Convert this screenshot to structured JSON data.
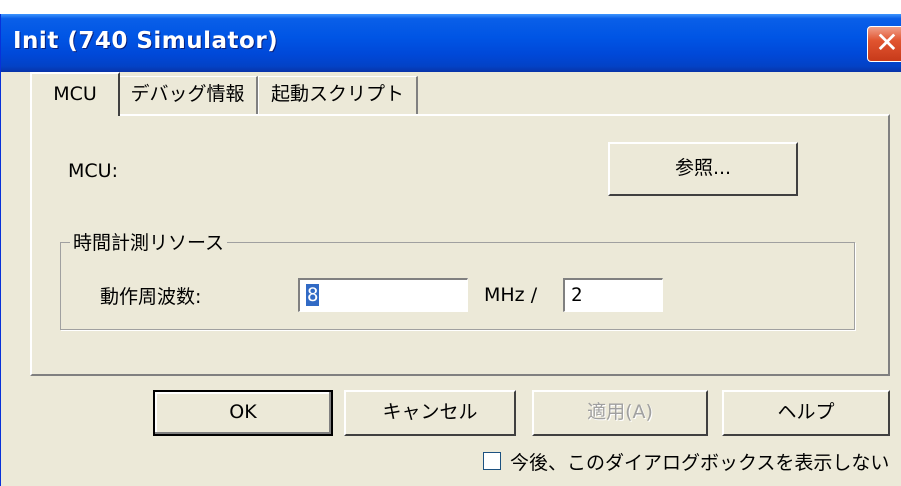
{
  "window": {
    "title": "Init (740 Simulator)"
  },
  "tabs": [
    {
      "label": "MCU",
      "active": true
    },
    {
      "label": "デバッグ情報",
      "active": false
    },
    {
      "label": "起動スクリプト",
      "active": false
    }
  ],
  "mcu": {
    "label": "MCU:",
    "browse_button": "参照..."
  },
  "timing_group": {
    "legend": "時間計測リソース",
    "freq_label": "動作周波数:",
    "freq_value": "8",
    "unit_label": "MHz /",
    "divider_value": "2"
  },
  "buttons": {
    "ok": "OK",
    "cancel": "キャンセル",
    "apply": "適用(A)",
    "help": "ヘルプ"
  },
  "checkbox": {
    "label": "今後、このダイアログボックスを表示しない",
    "checked": false
  }
}
